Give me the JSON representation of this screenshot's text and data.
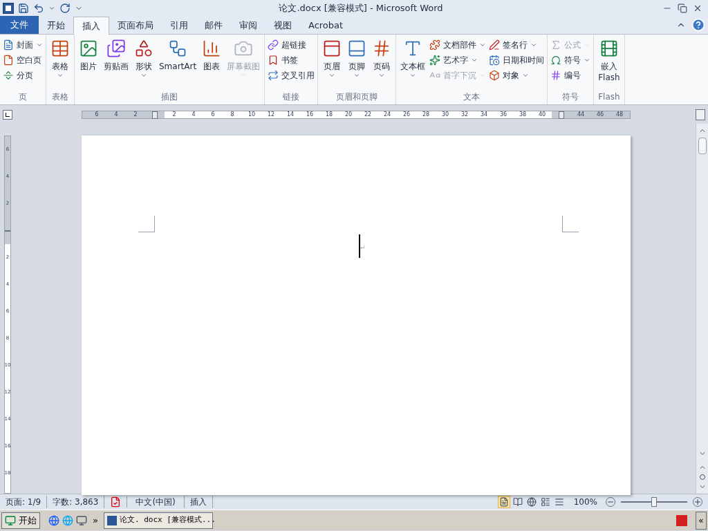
{
  "window": {
    "title": "论文.docx [兼容模式] - Microsoft Word"
  },
  "tabs": [
    {
      "label": "文件",
      "kind": "file",
      "selected": false
    },
    {
      "label": "开始",
      "kind": "tab",
      "selected": false
    },
    {
      "label": "插入",
      "kind": "tab",
      "selected": true
    },
    {
      "label": "页面布局",
      "kind": "tab",
      "selected": false
    },
    {
      "label": "引用",
      "kind": "tab",
      "selected": false
    },
    {
      "label": "邮件",
      "kind": "tab",
      "selected": false
    },
    {
      "label": "审阅",
      "kind": "tab",
      "selected": false
    },
    {
      "label": "视图",
      "kind": "tab",
      "selected": false
    },
    {
      "label": "Acrobat",
      "kind": "tab",
      "selected": false
    }
  ],
  "ribbon_groups": [
    {
      "label": "页",
      "columns": [
        [
          {
            "label": "封面",
            "dropdown": true,
            "disabled": false
          },
          {
            "label": "空白页",
            "dropdown": false,
            "disabled": false
          },
          {
            "label": "分页",
            "dropdown": false,
            "disabled": false
          }
        ]
      ]
    },
    {
      "label": "表格",
      "large": [
        {
          "label": "表格",
          "dropdown": true,
          "disabled": false
        }
      ]
    },
    {
      "label": "插图",
      "large": [
        {
          "label": "图片",
          "dropdown": false,
          "disabled": false
        },
        {
          "label": "剪贴画",
          "dropdown": false,
          "disabled": false
        },
        {
          "label": "形状",
          "dropdown": true,
          "disabled": false
        },
        {
          "label": "SmartArt",
          "dropdown": false,
          "disabled": false
        },
        {
          "label": "图表",
          "dropdown": false,
          "disabled": false
        },
        {
          "label": "屏幕截图",
          "dropdown": true,
          "disabled": true
        }
      ]
    },
    {
      "label": "链接",
      "columns": [
        [
          {
            "label": "超链接",
            "dropdown": false,
            "disabled": false
          },
          {
            "label": "书签",
            "dropdown": false,
            "disabled": false
          },
          {
            "label": "交叉引用",
            "dropdown": false,
            "disabled": false
          }
        ]
      ]
    },
    {
      "label": "页眉和页脚",
      "large": [
        {
          "label": "页眉",
          "dropdown": true,
          "disabled": false
        },
        {
          "label": "页脚",
          "dropdown": true,
          "disabled": false
        },
        {
          "label": "页码",
          "dropdown": true,
          "disabled": false
        }
      ]
    },
    {
      "label": "文本",
      "large": [
        {
          "label": "文本框",
          "dropdown": true,
          "disabled": false
        }
      ],
      "columns": [
        [
          {
            "label": "文档部件",
            "dropdown": true,
            "disabled": false
          },
          {
            "label": "艺术字",
            "dropdown": true,
            "disabled": false
          },
          {
            "label": "首字下沉",
            "dropdown": true,
            "disabled": true
          }
        ],
        [
          {
            "label": "签名行",
            "dropdown": true,
            "disabled": false
          },
          {
            "label": "日期和时间",
            "dropdown": false,
            "disabled": false
          },
          {
            "label": "对象",
            "dropdown": true,
            "disabled": false
          }
        ]
      ]
    },
    {
      "label": "符号",
      "columns": [
        [
          {
            "label": "公式",
            "dropdown": true,
            "disabled": true
          },
          {
            "label": "符号",
            "dropdown": true,
            "disabled": false
          },
          {
            "label": "编号",
            "dropdown": false,
            "disabled": false
          }
        ]
      ]
    },
    {
      "label": "Flash",
      "large": [
        {
          "label": "嵌入\nFlash",
          "dropdown": false,
          "disabled": false
        }
      ]
    }
  ],
  "ruler": {
    "labels": [
      "6",
      "4",
      "2",
      "2",
      "4",
      "6",
      "8",
      "10",
      "12",
      "14",
      "16",
      "18",
      "20",
      "22",
      "24",
      "26",
      "28",
      "30",
      "32",
      "34",
      "36",
      "38",
      "40",
      "44",
      "46",
      "48"
    ]
  },
  "vertical_ruler": {
    "labels": [
      "6",
      "4",
      "2",
      "2",
      "4",
      "6",
      "8",
      "10",
      "12",
      "14",
      "16",
      "18"
    ]
  },
  "document": {
    "paragraph_mark": "↵"
  },
  "status_bar": {
    "page": "页面: 1/9",
    "words": "字数: 3,863",
    "language": "中文(中国)",
    "mode": "插入",
    "views": [
      {
        "selected": true
      },
      {
        "selected": false
      },
      {
        "selected": false
      },
      {
        "selected": false
      },
      {
        "selected": false
      }
    ],
    "zoom": "100%",
    "zoom_level": {
      "level": 0.5
    }
  },
  "taskbar": {
    "start": "开始",
    "more": "»",
    "task": "论文. docx [兼容模式...",
    "collapse": "«"
  }
}
